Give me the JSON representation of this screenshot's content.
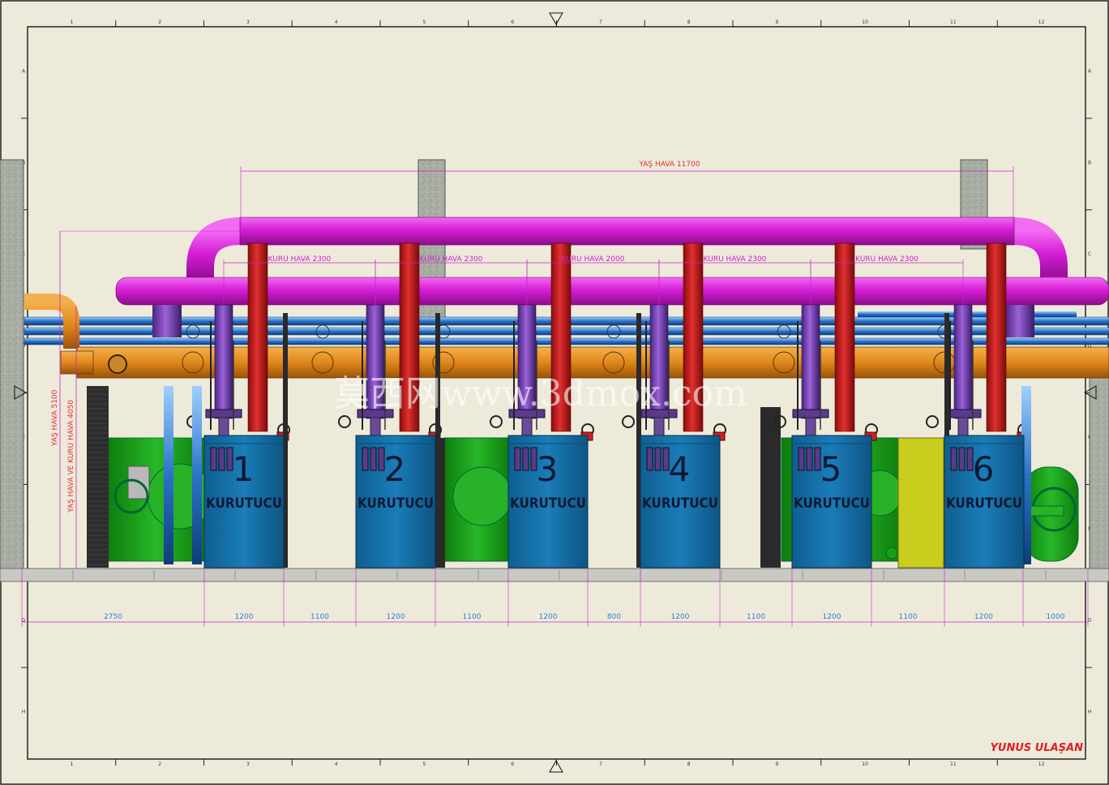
{
  "drawing": {
    "author": "YUNUS ULAŞAN",
    "watermark": "莫西网www.3dmox.com",
    "colors": {
      "paper": "#eeeada",
      "wet_air_pipe": "#d61ed6",
      "dry_air_pipe": "#8a4fc9",
      "hot_pipe": "#cf2020",
      "orange_duct": "#e0871a",
      "blue_pipe": "#2a73c9",
      "dryer_body": "#1470a8",
      "fan_green": "#1ea51e",
      "dimension_text": "#2f7fd2",
      "red_text": "#e03030",
      "magenta_text": "#cc22cc"
    }
  },
  "labels": {
    "wet_air_total": "YAŞ HAVA 11700",
    "dry_air": [
      "KURU HAVA 2300",
      "KURU HAVA 2300",
      "KURU HAVA 2000",
      "KURU HAVA 2300",
      "KURU HAVA 2300"
    ],
    "vertical_wet": "YAŞ HAVA 5100",
    "vertical_mixed": "YAŞ HAVA VE KURU HAVA 4050"
  },
  "dryers": [
    {
      "number": "1",
      "name": "KURUTUCU"
    },
    {
      "number": "2",
      "name": "KURUTUCU"
    },
    {
      "number": "3",
      "name": "KURUTUCU"
    },
    {
      "number": "4",
      "name": "KURUTUCU"
    },
    {
      "number": "5",
      "name": "KURUTUCU"
    },
    {
      "number": "6",
      "name": "KURUTUCU"
    }
  ],
  "bottom_dimensions": [
    "2750",
    "1200",
    "1100",
    "1200",
    "1100",
    "1200",
    "800",
    "1200",
    "1100",
    "1200",
    "1100",
    "1200",
    "1000"
  ],
  "border": {
    "column_numbers": [
      "1",
      "2",
      "3",
      "4",
      "5",
      "6",
      "7",
      "8",
      "9",
      "10",
      "11",
      "12"
    ],
    "row_letters": [
      "A",
      "B",
      "C",
      "D",
      "E",
      "F",
      "G",
      "H"
    ]
  }
}
